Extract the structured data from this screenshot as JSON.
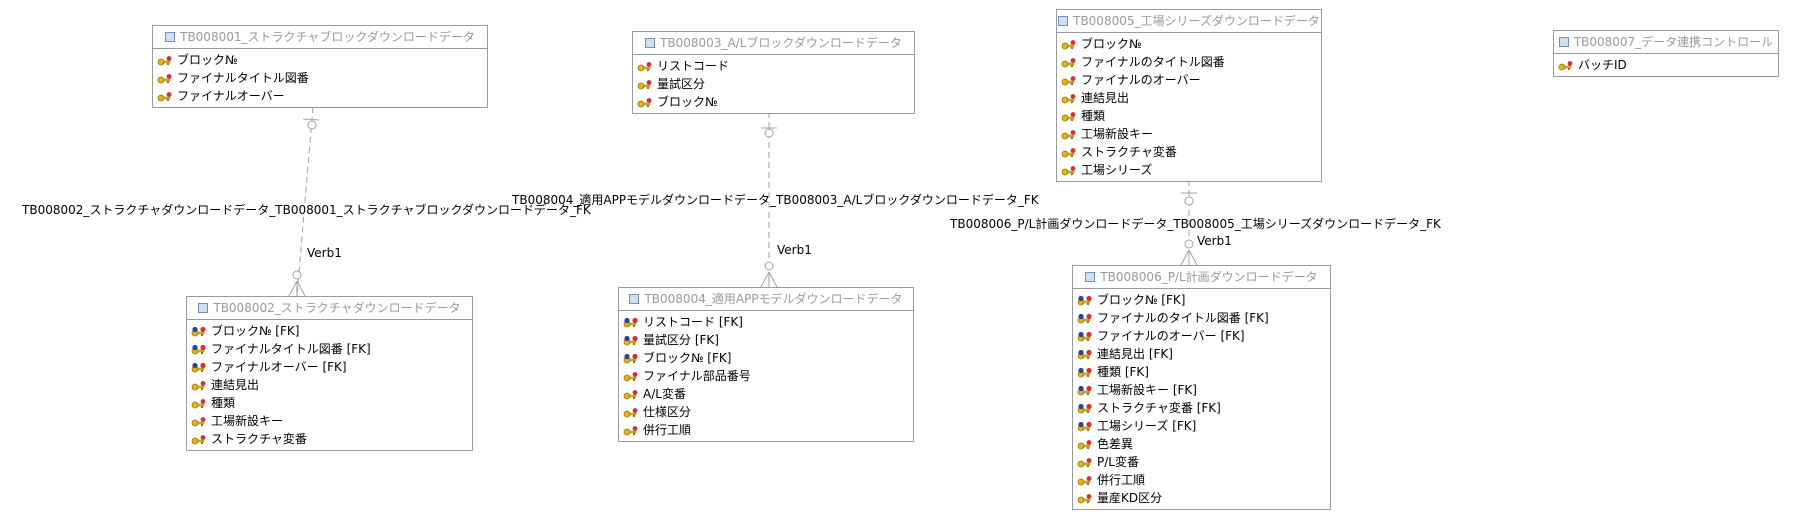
{
  "entities": {
    "e1": {
      "title": "TB008001_ストラクチャブロックダウンロードデータ",
      "attributes": [
        {
          "text": "ブロック№",
          "kind": "pk"
        },
        {
          "text": "ファイナルタイトル図番",
          "kind": "pk"
        },
        {
          "text": "ファイナルオーバー",
          "kind": "pk"
        }
      ]
    },
    "e2": {
      "title": "TB008002_ストラクチャダウンロードデータ",
      "attributes": [
        {
          "text": "ブロック№ [FK]",
          "kind": "pfk"
        },
        {
          "text": "ファイナルタイトル図番 [FK]",
          "kind": "pfk"
        },
        {
          "text": "ファイナルオーバー [FK]",
          "kind": "pfk"
        },
        {
          "text": "連結見出",
          "kind": "pk"
        },
        {
          "text": "種類",
          "kind": "pk"
        },
        {
          "text": "工場新設キー",
          "kind": "pk"
        },
        {
          "text": "ストラクチャ変番",
          "kind": "pk"
        }
      ]
    },
    "e3": {
      "title": "TB008003_A/Lブロックダウンロードデータ",
      "attributes": [
        {
          "text": "リストコード",
          "kind": "pk"
        },
        {
          "text": "量試区分",
          "kind": "pk"
        },
        {
          "text": "ブロック№",
          "kind": "pk"
        }
      ]
    },
    "e4": {
      "title": "TB008004_適用APPモデルダウンロードデータ",
      "attributes": [
        {
          "text": "リストコード [FK]",
          "kind": "pfk"
        },
        {
          "text": "量試区分 [FK]",
          "kind": "pfk"
        },
        {
          "text": "ブロック№ [FK]",
          "kind": "pfk"
        },
        {
          "text": "ファイナル部品番号",
          "kind": "pk"
        },
        {
          "text": "A/L変番",
          "kind": "pk"
        },
        {
          "text": "仕様区分",
          "kind": "pk"
        },
        {
          "text": "併行工順",
          "kind": "pk"
        }
      ]
    },
    "e5": {
      "title": "TB008005_工場シリーズダウンロードデータ",
      "attributes": [
        {
          "text": "ブロック№",
          "kind": "pk"
        },
        {
          "text": "ファイナルのタイトル図番",
          "kind": "pk"
        },
        {
          "text": "ファイナルのオーバー",
          "kind": "pk"
        },
        {
          "text": "連結見出",
          "kind": "pk"
        },
        {
          "text": "種類",
          "kind": "pk"
        },
        {
          "text": "工場新設キー",
          "kind": "pk"
        },
        {
          "text": "ストラクチャ変番",
          "kind": "pk"
        },
        {
          "text": "工場シリーズ",
          "kind": "pk"
        }
      ]
    },
    "e6": {
      "title": "TB008006_P/L計画ダウンロードデータ",
      "attributes": [
        {
          "text": "ブロック№ [FK]",
          "kind": "pfk"
        },
        {
          "text": "ファイナルのタイトル図番 [FK]",
          "kind": "pfk"
        },
        {
          "text": "ファイナルのオーバー [FK]",
          "kind": "pfk"
        },
        {
          "text": "連結見出 [FK]",
          "kind": "pfk"
        },
        {
          "text": "種類 [FK]",
          "kind": "pfk"
        },
        {
          "text": "工場新設キー [FK]",
          "kind": "pfk"
        },
        {
          "text": "ストラクチャ変番 [FK]",
          "kind": "pfk"
        },
        {
          "text": "工場シリーズ [FK]",
          "kind": "pfk"
        },
        {
          "text": "色差異",
          "kind": "pk"
        },
        {
          "text": "P/L変番",
          "kind": "pk"
        },
        {
          "text": "併行工順",
          "kind": "pk"
        },
        {
          "text": "量産KD区分",
          "kind": "pk"
        }
      ]
    },
    "e7": {
      "title": "TB008007_データ連携コントロール",
      "attributes": [
        {
          "text": "バッチID",
          "kind": "pk"
        }
      ]
    }
  },
  "relationships": {
    "r1": {
      "label": "TB008002_ストラクチャダウンロードデータ_TB008001_ストラクチャブロックダウンロードデータ_FK",
      "verb": "Verb1"
    },
    "r2": {
      "label": "TB008004_適用APPモデルダウンロードデータ_TB008003_A/Lブロックダウンロードデータ_FK",
      "verb": "Verb1"
    },
    "r3": {
      "label": "TB008006_P/L計画ダウンロードデータ_TB008005_工場シリーズダウンロードデータ_FK",
      "verb": "Verb1"
    }
  },
  "colors": {
    "border": "#9a9a9a",
    "header_text": "#9a9a9a",
    "line": "#a0a0a0",
    "key_gold": "#e3b424",
    "fk_blue": "#2a3f9e",
    "fk_red": "#d3313a"
  }
}
